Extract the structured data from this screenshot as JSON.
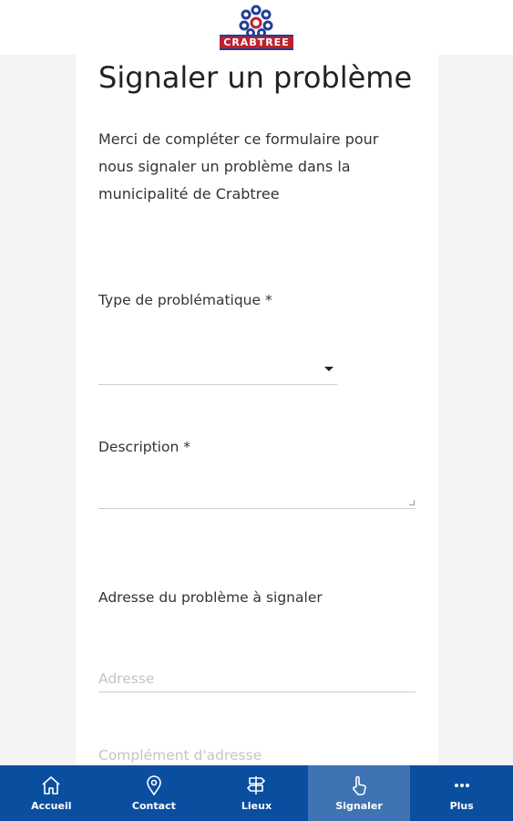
{
  "header": {
    "logo_text": "CRABTREE"
  },
  "form": {
    "title": "Signaler un problème",
    "intro": "Merci de compléter ce formulaire pour nous signaler un problème dans la municipalité de Crabtree",
    "type_label": "Type de problématique *",
    "type_value": "",
    "description_label": "Description *",
    "address_section_label": "Adresse du problème à signaler",
    "address_placeholder": "Adresse",
    "address_complement_placeholder": "Complément d'adresse"
  },
  "nav": {
    "items": [
      {
        "label": "Accueil",
        "icon": "home-icon"
      },
      {
        "label": "Contact",
        "icon": "location-pin-icon"
      },
      {
        "label": "Lieux",
        "icon": "signpost-icon"
      },
      {
        "label": "Signaler",
        "icon": "pointer-hand-icon",
        "active": true
      },
      {
        "label": "Plus",
        "icon": "more-dots-icon"
      }
    ]
  },
  "colors": {
    "nav_background": "#0a4ea0",
    "nav_active": "#3f73b3",
    "logo_blue": "#1f3f97",
    "logo_red": "#c0202b"
  }
}
